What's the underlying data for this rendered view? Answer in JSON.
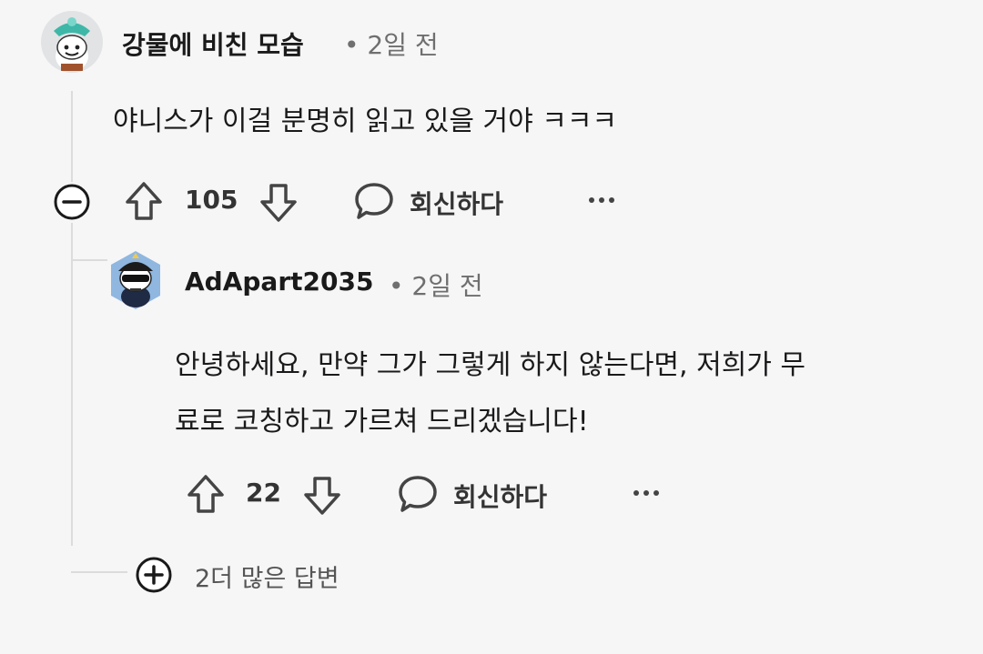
{
  "comments": [
    {
      "author": "강물에 비친 모습",
      "time": "2일 전",
      "body": "야니스가 이걸 분명히 읽고 있을 거야 ㅋㅋㅋ",
      "votes": "105",
      "reply_label": "회신하다",
      "avatar_icon": "snoo-avatar-teal-hat"
    },
    {
      "author": "AdApart2035",
      "time": "2일 전",
      "body_lines": [
        "안녕하세요, 만약 그가 그렇게 하지 않는다면, 저희가 무",
        "료로 코칭하고 가르쳐 드리겠습니다!"
      ],
      "votes": "22",
      "reply_label": "회신하다",
      "avatar_icon": "snoo-avatar-sunglasses-cap"
    }
  ],
  "more_replies": "2더 많은 답변",
  "icons": {
    "collapse": "collapse-minus-icon",
    "upvote": "upvote-arrow-icon",
    "downvote": "downvote-arrow-icon",
    "reply": "speech-bubble-icon",
    "more": "more-dots-icon",
    "expand": "expand-plus-icon"
  }
}
